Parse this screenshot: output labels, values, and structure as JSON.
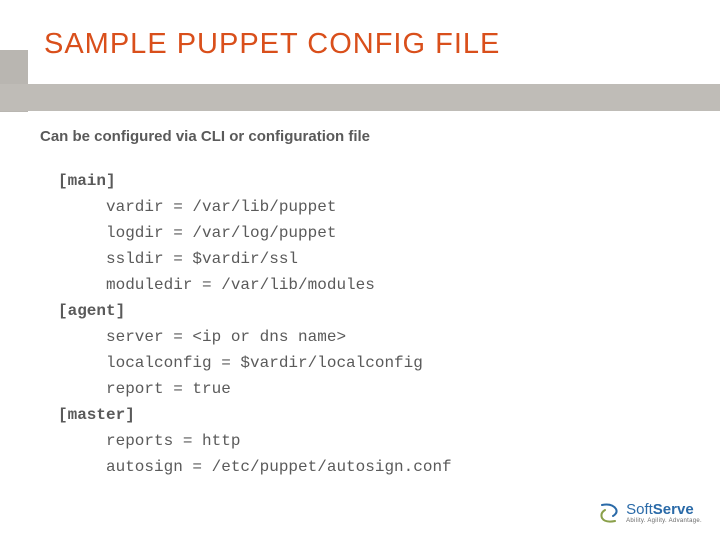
{
  "title": "SAMPLE PUPPET CONFIG FILE",
  "subtitle": "Can be configured via CLI or configuration file",
  "config": {
    "sections": [
      {
        "name": "[main]",
        "entries": [
          "vardir = /var/lib/puppet",
          "logdir = /var/log/puppet",
          "ssldir = $vardir/ssl",
          "moduledir = /var/lib/modules"
        ]
      },
      {
        "name": "[agent]",
        "entries": [
          "server = <ip or dns name>",
          "localconfig = $vardir/localconfig",
          "report = true"
        ]
      },
      {
        "name": "[master]",
        "entries": [
          "reports = http",
          "autosign = /etc/puppet/autosign.conf"
        ]
      }
    ]
  },
  "logo": {
    "name_prefix": "Soft",
    "name_suffix": "Serve",
    "tagline": "Ability. Agility. Advantage."
  }
}
